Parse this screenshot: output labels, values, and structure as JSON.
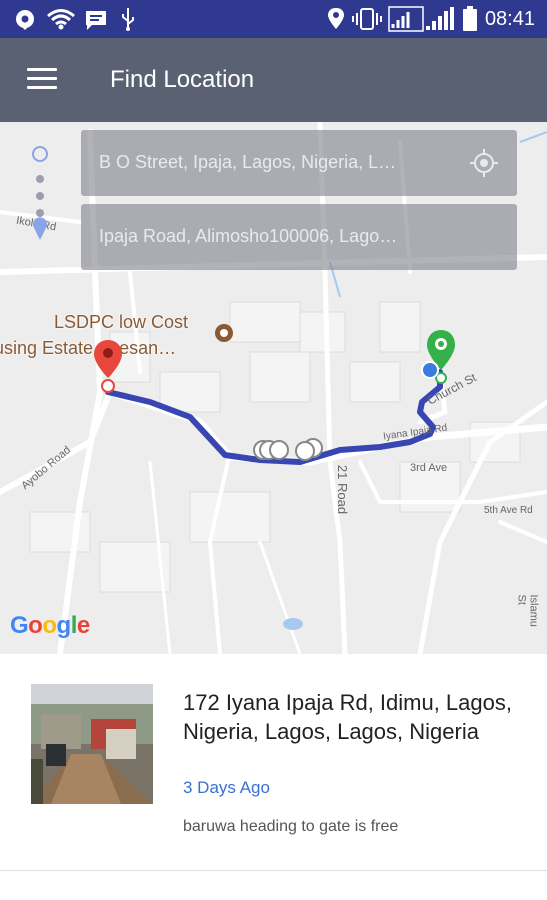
{
  "status_bar": {
    "time": "08:41",
    "icons": [
      "location-pin-icon",
      "wifi-icon",
      "message-icon",
      "usb-icon",
      "location-icon",
      "vibrate-icon",
      "signal-icon",
      "battery-icon"
    ]
  },
  "app_bar": {
    "title": "Find Location",
    "menu_icon": "hamburger-menu-icon"
  },
  "search": {
    "from": "B O Street, Ipaja, Lagos, Nigeria, L…",
    "to": "Ipaja Road, Alimosho100006, Lago…",
    "gps_icon": "gps-locate-icon"
  },
  "map": {
    "poi_line1": "LSDPC low Cost",
    "poi_line2": "using Estate Abesan…",
    "road_labels": {
      "ikola": "Ikola Rd",
      "church": "Church St",
      "iyana": "Iyana Ipaja Rd",
      "ayobo": "Ayobo Road",
      "road21": "21 Road",
      "ave3rd": "3rd Ave",
      "ave5th": "5th Ave Rd",
      "islamu": "Islamu St"
    },
    "route_color": "#3846b2",
    "start_marker_color": "#34b249",
    "end_marker_color": "#e8473d",
    "google": [
      "G",
      "o",
      "o",
      "g",
      "l",
      "e"
    ]
  },
  "result": {
    "address": "172 Iyana Ipaja Rd, Idimu, Lagos, Nigeria, Lagos, Lagos, Nigeria",
    "time_ago": "3 Days Ago",
    "note": "baruwa heading to gate is free"
  }
}
